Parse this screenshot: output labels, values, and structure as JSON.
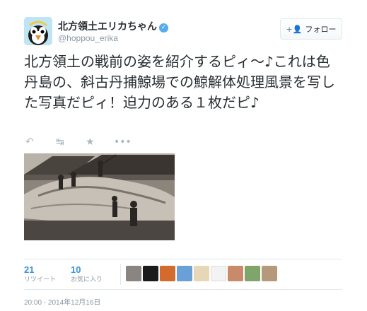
{
  "author": {
    "display_name": "北方領土エリカちゃん",
    "handle": "@hoppou_erika",
    "verified_badge": "verified-badge"
  },
  "follow_button": {
    "label": "フォロー",
    "icon": "add-user-icon"
  },
  "tweet": {
    "text": "北方領土の戦前の姿を紹介するピィ～♪これは色丹島の、斜古丹捕鯨場での鯨解体処理風景を写した写真だピィ！迫力のある１枚だピ♪"
  },
  "actions": {
    "icons": [
      "reply-icon",
      "retweet-icon",
      "favorite-icon",
      "more-icon"
    ]
  },
  "stats": {
    "retweets": {
      "count": "21",
      "label": "リツイート"
    },
    "favorites": {
      "count": "10",
      "label": "お気に入り"
    }
  },
  "timestamp": "20:00 - 2014年12月16日",
  "colors": {
    "link": "#3b94d9",
    "muted": "#8899a6",
    "text": "#292f33",
    "border": "#e1e8ed"
  }
}
